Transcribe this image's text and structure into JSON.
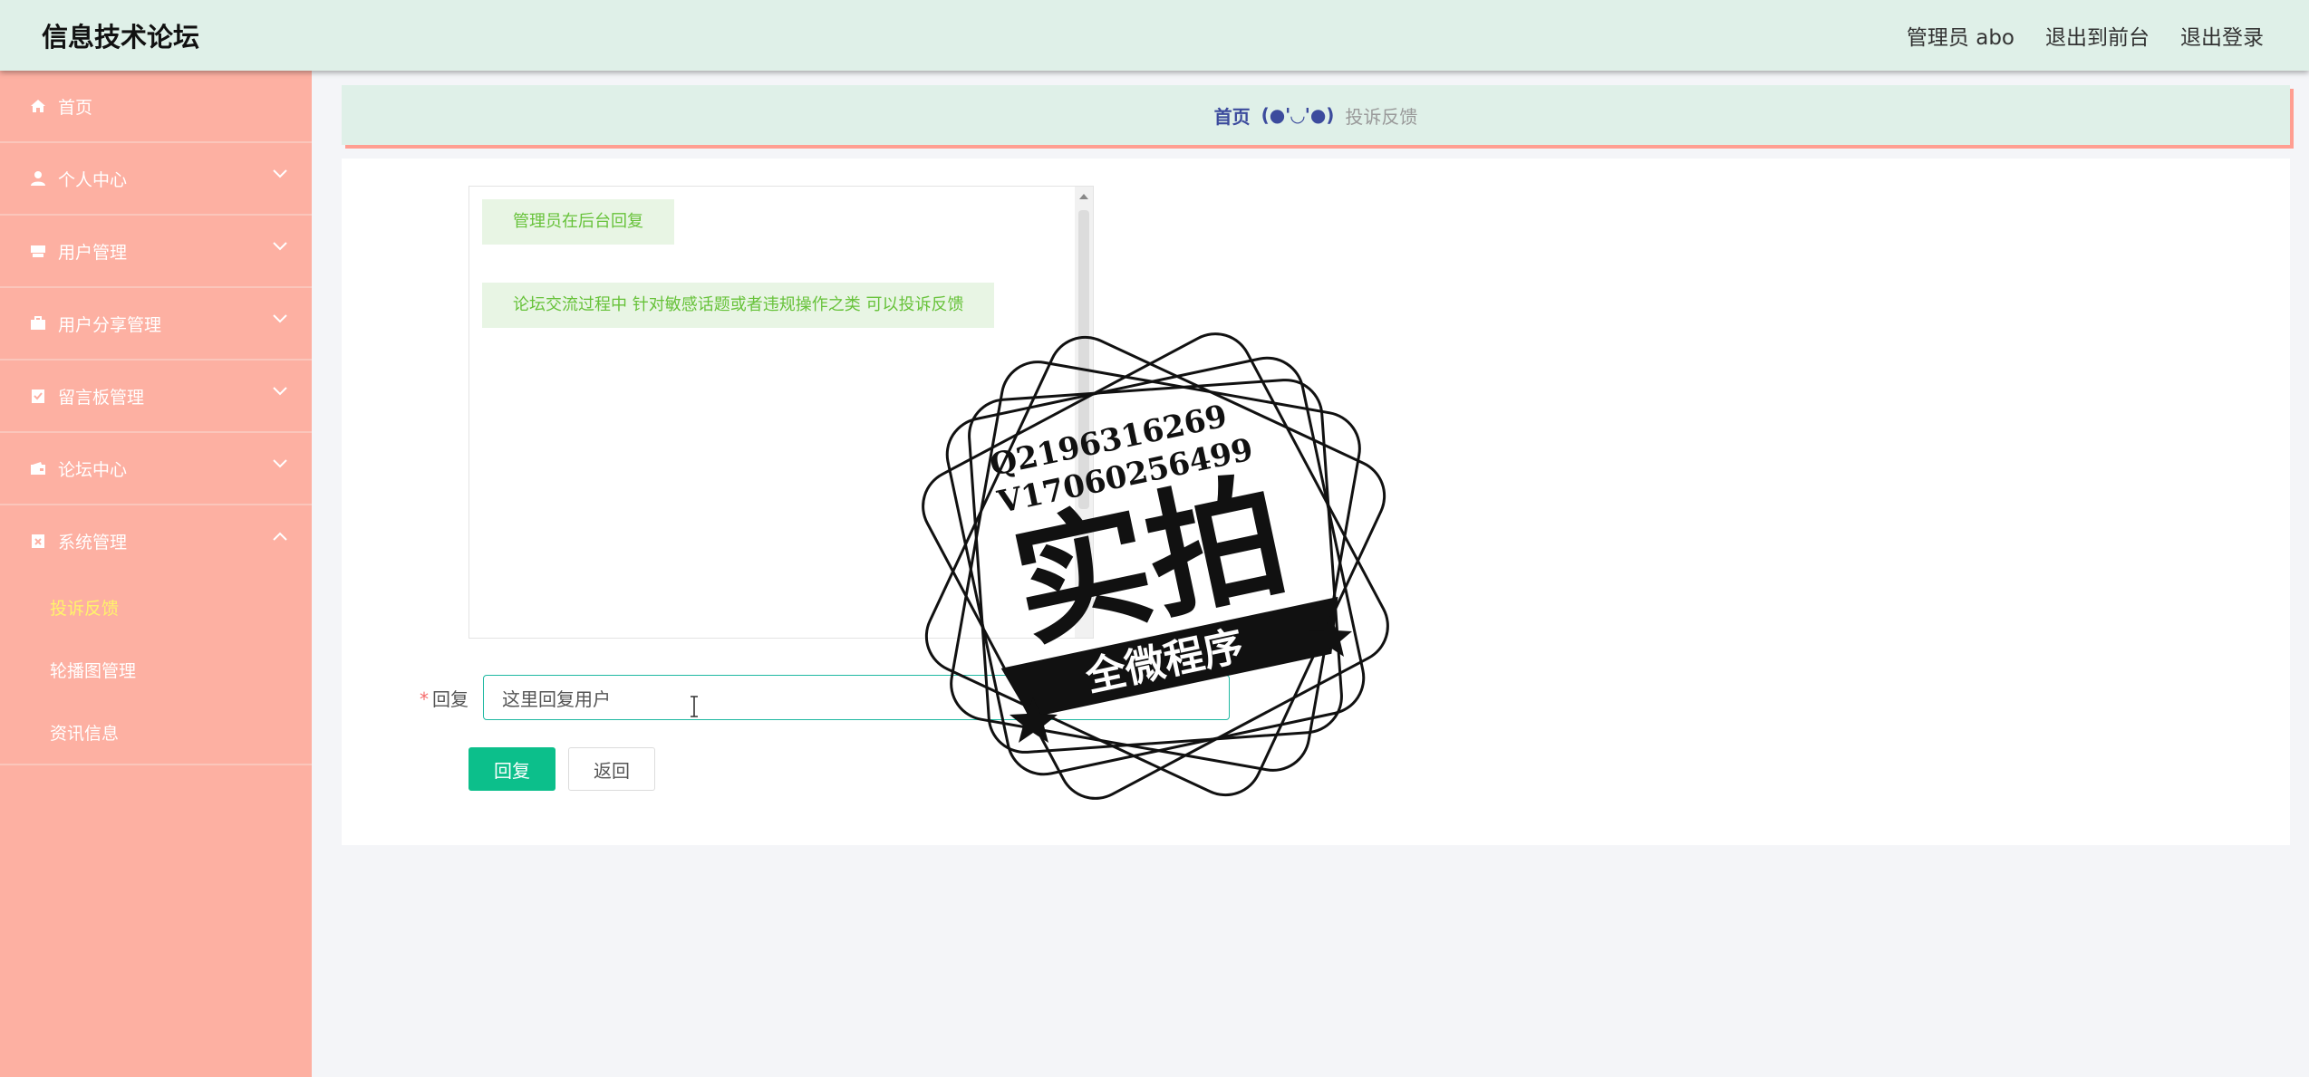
{
  "header": {
    "app_title": "信息技术论坛",
    "admin_label": "管理员 abo",
    "exit_front": "退出到前台",
    "logout": "退出登录"
  },
  "sidebar": {
    "items": [
      {
        "label": "首页",
        "icon": "home-icon"
      },
      {
        "label": "个人中心",
        "icon": "user-icon"
      },
      {
        "label": "用户管理",
        "icon": "folder-icon"
      },
      {
        "label": "用户分享管理",
        "icon": "briefcase-icon"
      },
      {
        "label": "留言板管理",
        "icon": "clipboard-check-icon"
      },
      {
        "label": "论坛中心",
        "icon": "wallet-icon"
      },
      {
        "label": "系统管理",
        "icon": "clipboard-x-icon"
      }
    ],
    "sub_items": [
      {
        "label": "投诉反馈",
        "active": true
      },
      {
        "label": "轮播图管理",
        "active": false
      },
      {
        "label": "资讯信息",
        "active": false
      }
    ]
  },
  "breadcrumb": {
    "home": "首页",
    "separator": "(●'◡'●)",
    "current": "投诉反馈"
  },
  "chat": {
    "messages": [
      "管理员在后台回复",
      "论坛交流过程中 针对敏感话题或者违规操作之类 可以投诉反馈"
    ]
  },
  "form": {
    "required_mark": "*",
    "reply_label": "回复",
    "reply_value": "这里回复用户"
  },
  "buttons": {
    "reply": "回复",
    "back": "返回"
  },
  "watermark": {
    "line1": "Q2196316269",
    "line2": "V17060256499",
    "big": "实拍",
    "banner": "全微程序"
  },
  "colors": {
    "header_bg": "#dff0e8",
    "sidebar_bg": "#fdb0a2",
    "active_sub": "#fff36b",
    "primary": "#0cbf8b",
    "breadcrumb_home": "#3c4b9d",
    "message_text": "#67c23a"
  }
}
